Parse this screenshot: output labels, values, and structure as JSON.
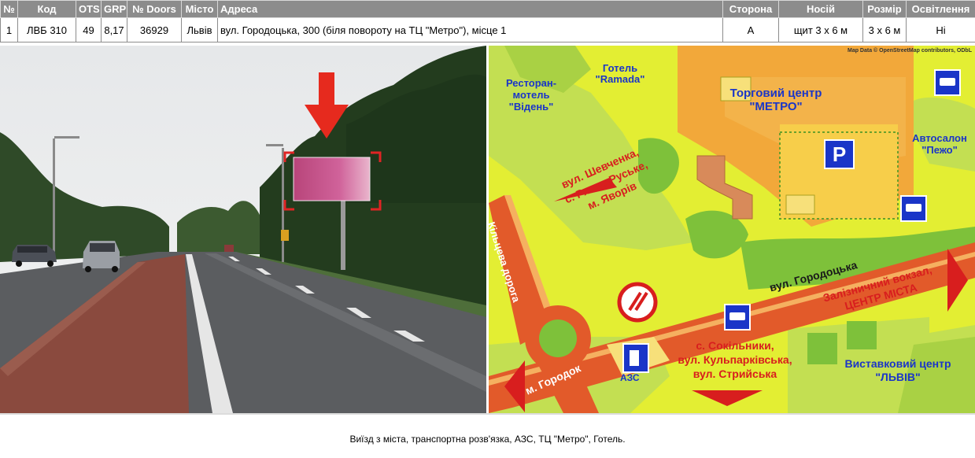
{
  "table": {
    "headers": {
      "num": "№",
      "code": "Код",
      "ots": "OTS",
      "grp": "GRP",
      "doors": "№ Doors",
      "city": "Місто",
      "address": "Адреса",
      "side": "Сторона",
      "carrier": "Носій",
      "size": "Розмір",
      "lighting": "Освітлення"
    },
    "row": {
      "num": "1",
      "code": "ЛВБ 310",
      "ots": "49",
      "grp": "8,17",
      "doors": "36929",
      "city": "Львів",
      "address": "вул. Городоцька, 300 (біля повороту на ТЦ \"Метро\"), місце 1",
      "side": "А",
      "carrier": "щит 3 х 6 м",
      "size": "3 х 6 м",
      "lighting": "Ні"
    }
  },
  "map": {
    "attribution": "Map Data © OpenStreetMap contributors, ODbL",
    "labels": {
      "hotel_ramada": [
        "Готель",
        "\"Ramada\""
      ],
      "motel_viden": [
        "Ресторан-",
        "мотель",
        "\"Відень\""
      ],
      "metro_center": [
        "Торговий центр",
        "\"МЕТРО\""
      ],
      "autosalon": [
        "Автосалон",
        "\"Пежо\""
      ],
      "parking": "P",
      "dir_shevchenka": [
        "вул. Шевченка,",
        "с. Рясне-Руське,",
        "м. Яворів"
      ],
      "kiltseva": "Кільцева дорога",
      "gorodotska": "вул. Городоцька",
      "zaliznychnyi": [
        "Залізничний вокзал,",
        "ЦЕНТР МІСТА"
      ],
      "gorodok": "м. Городок",
      "azs": "АЗС",
      "sokilnyky": [
        "с. Сокільники,",
        "вул. Кульпарківська,",
        "вул. Стрийська"
      ],
      "vystavkovyi": [
        "Виставковий центр",
        "\"ЛЬВІВ\""
      ]
    }
  },
  "caption": "Виїзд з міста, транспортна розв'язка, АЗС, ТЦ \"Метро\", Готель.",
  "colors": {
    "header_bg": "#8c8c8c",
    "map_yellow": "#e3ee33",
    "map_green": "#7ec13a",
    "map_orange": "#f0a030",
    "road_red": "#e23a2a",
    "label_red": "#d81e1e",
    "label_blue": "#1a35c8"
  }
}
